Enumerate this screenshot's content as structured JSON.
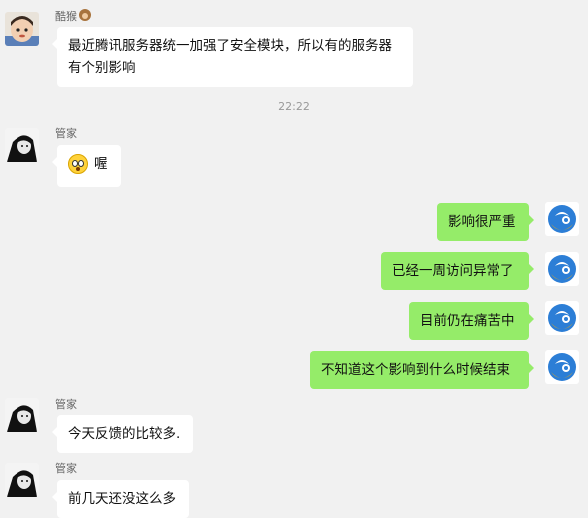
{
  "messages": [
    {
      "sender": "酷猴",
      "text_line1": "最近腾讯服务器统一加强了安全模块，所以有的服务器",
      "text_line2": "有个别影响"
    },
    {
      "sender": "管家",
      "text": "喔"
    },
    {
      "sender": "管家",
      "text": "今天反馈的比较多."
    },
    {
      "sender": "管家",
      "text": "前几天还没这么多"
    }
  ],
  "timestamp": "22:22",
  "mine": [
    {
      "text": "影响很严重"
    },
    {
      "text": "已经一周访问异常了"
    },
    {
      "text": "目前仍在痛苦中"
    },
    {
      "text": "不知道这个影响到什么时候结束"
    }
  ]
}
